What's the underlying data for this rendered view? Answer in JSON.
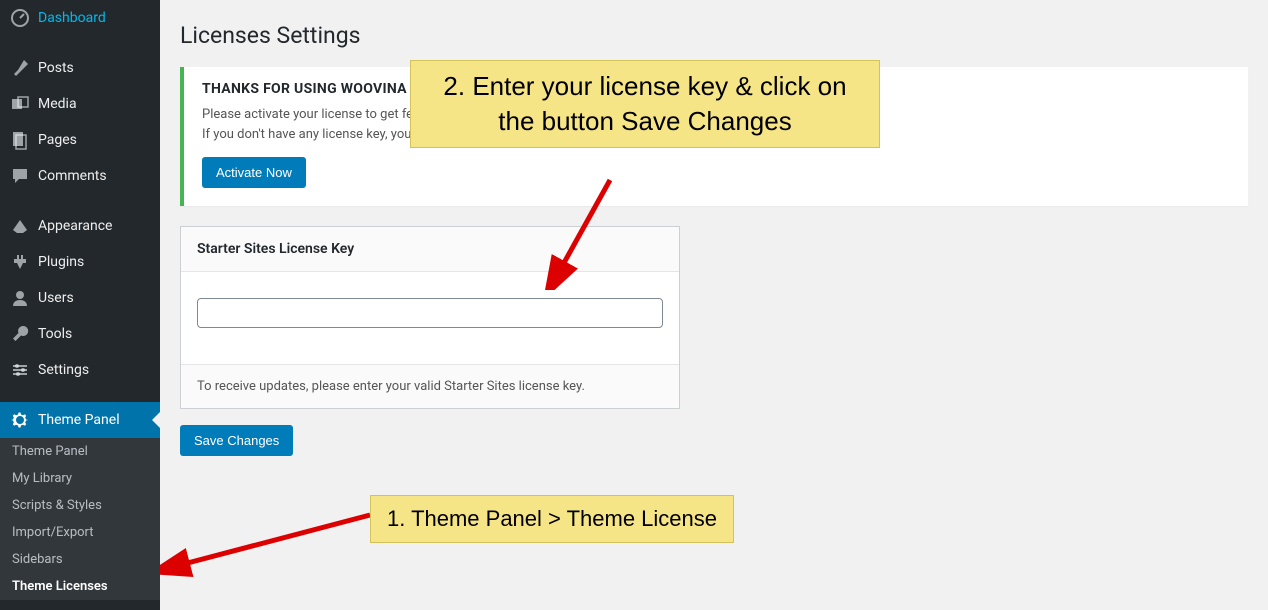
{
  "sidebar": {
    "items": [
      {
        "label": "Dashboard",
        "icon": "dashboard-icon"
      },
      {
        "label": "Posts",
        "icon": "pin-icon"
      },
      {
        "label": "Media",
        "icon": "media-icon"
      },
      {
        "label": "Pages",
        "icon": "pages-icon"
      },
      {
        "label": "Comments",
        "icon": "comments-icon"
      },
      {
        "label": "Appearance",
        "icon": "appearance-icon"
      },
      {
        "label": "Plugins",
        "icon": "plugins-icon"
      },
      {
        "label": "Users",
        "icon": "users-icon"
      },
      {
        "label": "Tools",
        "icon": "tools-icon"
      },
      {
        "label": "Settings",
        "icon": "settings-icon"
      },
      {
        "label": "Theme Panel",
        "icon": "gear-icon"
      }
    ],
    "sub_items": [
      {
        "label": "Theme Panel"
      },
      {
        "label": "My Library"
      },
      {
        "label": "Scripts & Styles"
      },
      {
        "label": "Import/Export"
      },
      {
        "label": "Sidebars"
      },
      {
        "label": "Theme Licenses"
      }
    ]
  },
  "page": {
    "title": "Licenses Settings"
  },
  "notice": {
    "heading": "THANKS FOR USING WOOVINA STARTER SITES",
    "line1": "Please activate your license to get feature updates, premium support and unlimited access to the demos library.",
    "line2": "If you don't have any license key, you can get one from here: ",
    "button": "Activate Now"
  },
  "panel": {
    "header": "Starter Sites License Key",
    "input_value": "",
    "footer": "To receive updates, please enter your valid Starter Sites license key."
  },
  "save_button": "Save Changes",
  "annotations": {
    "step1": "1. Theme Panel > Theme License",
    "step2": "2. Enter your license key & click on the button Save Changes"
  }
}
